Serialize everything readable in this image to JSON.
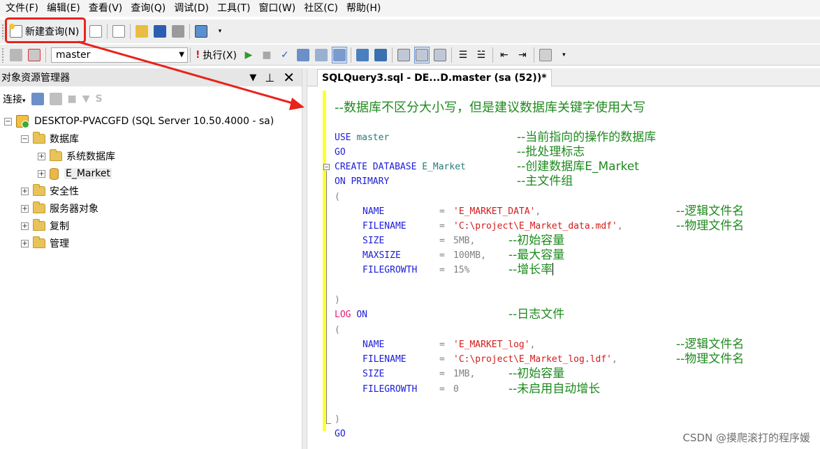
{
  "menu": [
    "文件(F)",
    "编辑(E)",
    "查看(V)",
    "查询(Q)",
    "调试(D)",
    "工具(T)",
    "窗口(W)",
    "社区(C)",
    "帮助(H)"
  ],
  "toolbar": {
    "new_query_label": "新建查询(N)",
    "database": "master",
    "execute_label": "执行(X)"
  },
  "object_explorer": {
    "title": "对象资源管理器",
    "connect_label": "连接",
    "server": "DESKTOP-PVACGFD (SQL Server 10.50.4000 - sa)",
    "nodes": {
      "databases": "数据库",
      "system_databases": "系统数据库",
      "e_market": "E_Market",
      "security": "安全性",
      "server_objects": "服务器对象",
      "replication": "复制",
      "management": "管理"
    }
  },
  "editor": {
    "tab_title": "SQLQuery3.sql - DE...D.master (sa (52))*",
    "lines": {
      "l0_cmt": "--数据库不区分大小写，但是建议数据库关键字使用大写",
      "l1_kw": "USE",
      "l1_id": "master",
      "l1_cmt": "--当前指向的操作的数据库",
      "l2_kw": "GO",
      "l2_cmt": "--批处理标志",
      "l3_kw": "CREATE DATABASE",
      "l3_id": "E_Market",
      "l3_cmt": "--创建数据库E_Market",
      "l4_kw": "ON PRIMARY",
      "l4_cmt": "--主文件组",
      "l5": "(",
      "l6_key": "NAME",
      "l6_str": "'E_MARKET_DATA'",
      "l6_cmt": "--逻辑文件名",
      "l7_key": "FILENAME",
      "l7_str": "'C:\\project\\E_Market_data.mdf'",
      "l7_cmt": "--物理文件名",
      "l8_key": "SIZE",
      "l8_val": "5MB",
      "l8_cmt": "--初始容量",
      "l9_key": "MAXSIZE",
      "l9_val": "100MB",
      "l9_cmt": "--最大容量",
      "l10_key": "FILEGROWTH",
      "l10_val": "15%",
      "l10_cmt": "--增长率",
      "l11": ")",
      "l12_kw1": "LOG",
      "l12_kw2": "ON",
      "l12_cmt": "--日志文件",
      "l13": "(",
      "l14_key": "NAME",
      "l14_str": "'E_MARKET_log'",
      "l14_cmt": "--逻辑文件名",
      "l15_key": "FILENAME",
      "l15_str": "'C:\\project\\E_Market_log.ldf'",
      "l15_cmt": "--物理文件名",
      "l16_key": "SIZE",
      "l16_val": "1MB",
      "l16_cmt": "--初始容量",
      "l17_key": "FILEGROWTH",
      "l17_val": "0",
      "l17_cmt": "--未启用自动增长",
      "l18": ")",
      "l19_kw": "GO"
    }
  },
  "watermark": "CSDN @摸爬滚打的程序媛"
}
